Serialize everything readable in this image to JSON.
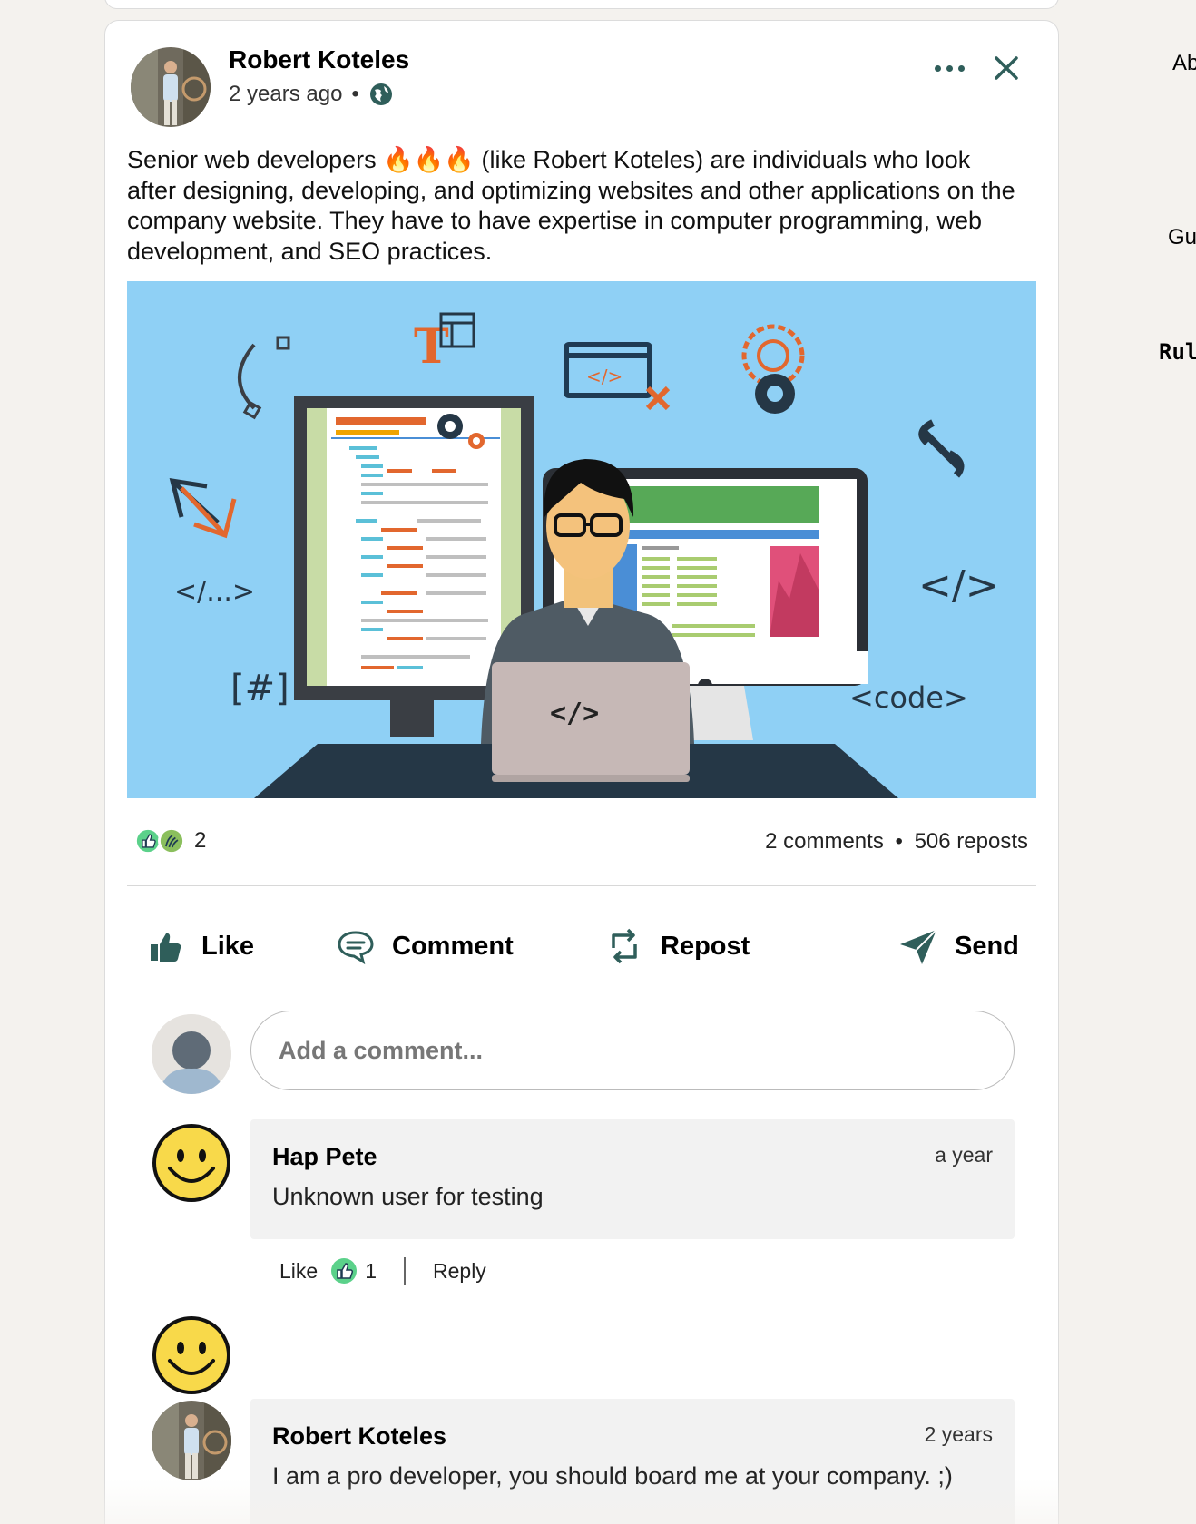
{
  "post": {
    "author": "Robert Koteles",
    "time": "2 years ago",
    "separator": "•",
    "body": "Senior web developers 🔥🔥🔥 (like Robert Koteles) are individuals who look after designing, developing, and optimizing websites and other applications on the company website. They have to have expertise in computer programming, web development, and SEO practices.",
    "image": {
      "code_symbols": [
        "</...>",
        "</>",
        "[#]",
        "<code>",
        "</>",
        "</>"
      ],
      "font_letter": "T"
    },
    "reaction_count": "2",
    "comments": "2 comments",
    "dot": "•",
    "reposts": "506 reposts"
  },
  "actions": {
    "like": "Like",
    "comment": "Comment",
    "repost": "Repost",
    "send": "Send"
  },
  "comment_box": {
    "placeholder": "Add a comment..."
  },
  "comments": [
    {
      "author": "Hap Pete",
      "time": "a year",
      "text": "Unknown user for testing",
      "like_label": "Like",
      "like_count": "1",
      "reply_label": "Reply"
    },
    {
      "author": "Robert Koteles",
      "time": "2 years",
      "text": "I am a pro developer, you should board me at your company. ;)"
    }
  ],
  "right_sidebar": {
    "fragments": [
      "Ab",
      "Gu",
      "Rul"
    ]
  },
  "colors": {
    "accent": "#2f5e5a",
    "image_bg": "#8fd0f5",
    "orange": "#e2672e",
    "navy": "#1f3b53"
  },
  "icons": [
    "globe-icon",
    "more-icon",
    "close-icon",
    "like-icon",
    "comment-icon",
    "repost-icon",
    "send-icon",
    "smiley-icon",
    "celebrate-icon"
  ]
}
